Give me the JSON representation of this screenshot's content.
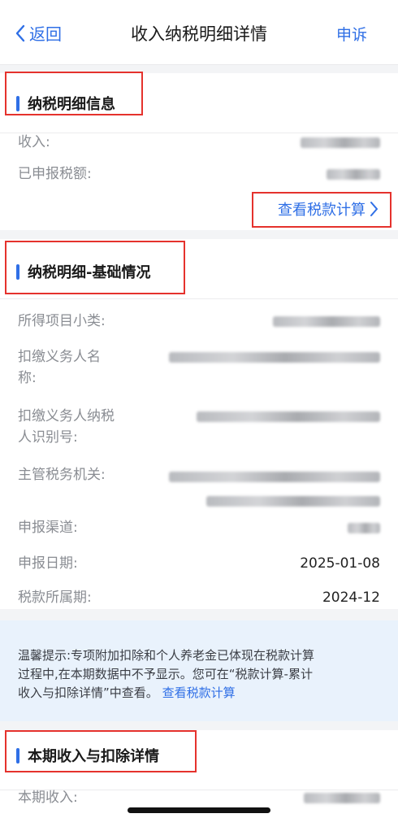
{
  "nav": {
    "back_label": "返回",
    "title": "收入纳税明细详情",
    "appeal_label": "申诉"
  },
  "section1": {
    "title": "纳税明细信息",
    "rows": [
      {
        "label": "收入:"
      },
      {
        "label": "已申报税额:"
      }
    ],
    "calc_link": "查看税款计算"
  },
  "section2": {
    "title": "纳税明细-基础情况",
    "rows": [
      {
        "label_l1": "所得项目小类:"
      },
      {
        "label_l1": "扣缴义务人名",
        "label_l2": "称:"
      },
      {
        "label_l1": "扣缴义务人纳税",
        "label_l2": "人识别号:"
      },
      {
        "label_l1": "主管税务机关:"
      },
      {
        "label_l1": "申报渠道:"
      },
      {
        "label_l1": "申报日期:",
        "value": "2025-01-08"
      },
      {
        "label_l1": "税款所属期:",
        "value": "2024-12"
      }
    ]
  },
  "tip": {
    "line1": "温馨提示:专项附加扣除和个人养老金已体现在税款计算",
    "line2": "过程中,在本期数据中不予显示。您可在“税款计算-累计",
    "line3": "收入与扣除详情”中查看。",
    "link": "查看税款计算"
  },
  "section3": {
    "title": "本期收入与扣除详情",
    "rows": [
      {
        "label": "本期收入:"
      }
    ]
  },
  "colors": {
    "accent": "#2f6fe6",
    "annotation_red": "#e5322d",
    "tip_bg": "#e9f2fc"
  }
}
